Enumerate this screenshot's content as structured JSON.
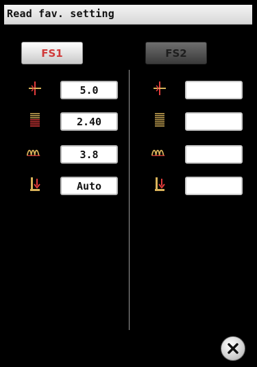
{
  "window": {
    "title": "Read fav. setting"
  },
  "tabs": [
    {
      "label": "FS1",
      "active": true
    },
    {
      "label": "FS2",
      "active": false
    }
  ],
  "settings": {
    "fs1": {
      "stitch_width": "5.0",
      "stitch_density": "2.40",
      "stitch_length": "3.8",
      "thread_tension": "Auto"
    },
    "fs2": {
      "stitch_width": "",
      "stitch_density": "",
      "stitch_length": "",
      "thread_tension": ""
    }
  },
  "icons": {
    "width": "stitch-width-icon",
    "density": "stitch-density-icon",
    "length": "stitch-length-icon",
    "tension": "thread-tension-icon",
    "close": "close-icon"
  },
  "colors": {
    "accent_red": "#e23b3b",
    "icon_gold": "#d9b35a",
    "titlebar": "#e6e6e6"
  }
}
